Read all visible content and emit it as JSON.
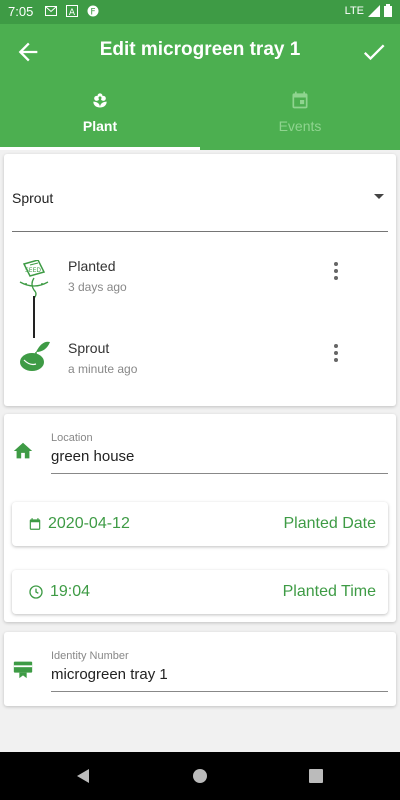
{
  "status_bar": {
    "time": "7:05",
    "network": "LTE"
  },
  "app_bar": {
    "title": "Edit microgreen tray 1"
  },
  "tabs": [
    {
      "label": "Plant",
      "active": true
    },
    {
      "label": "Events",
      "active": false
    }
  ],
  "stage_selector": {
    "value": "Sprout"
  },
  "stages": [
    {
      "title": "Planted",
      "subtitle": "3 days ago"
    },
    {
      "title": "Sprout",
      "subtitle": "a minute ago"
    }
  ],
  "location": {
    "label": "Location",
    "value": "green house"
  },
  "planted_date": {
    "value": "2020-04-12",
    "label": "Planted Date"
  },
  "planted_time": {
    "value": "19:04",
    "label": "Planted Time"
  },
  "identity": {
    "label": "Identity Number",
    "value": "microgreen tray 1"
  },
  "colors": {
    "primary": "#4caf50",
    "dark": "#3e9b45",
    "tab_inactive": "#8fd48f"
  }
}
